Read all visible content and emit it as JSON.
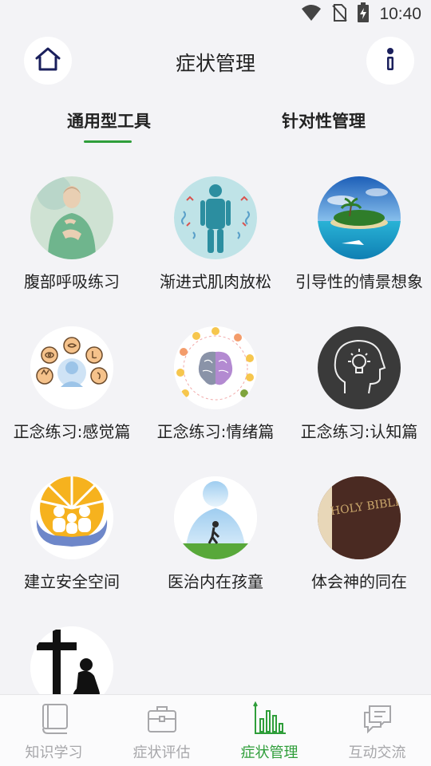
{
  "status_bar": {
    "time": "10:40",
    "icons": [
      "wifi-icon",
      "no-sim-icon",
      "battery-charging-icon"
    ]
  },
  "header": {
    "title": "症状管理",
    "left_icon": "home-icon",
    "right_icon": "info-icon"
  },
  "tabs": [
    {
      "label": "通用型工具",
      "active": true
    },
    {
      "label": "针对性管理",
      "active": false
    }
  ],
  "tools": [
    {
      "label": "腹部呼吸练习",
      "icon": "abdominal-breathing-image"
    },
    {
      "label": "渐进式肌肉放松",
      "icon": "muscle-relaxation-image"
    },
    {
      "label": "引导性的情景想象",
      "icon": "guided-imagery-image"
    },
    {
      "label": "正念练习:感觉篇",
      "icon": "mindfulness-senses-image"
    },
    {
      "label": "正念练习:情绪篇",
      "icon": "mindfulness-emotions-image"
    },
    {
      "label": "正念练习:认知篇",
      "icon": "mindfulness-cognition-image"
    },
    {
      "label": "建立安全空间",
      "icon": "safe-space-image"
    },
    {
      "label": "医治内在孩童",
      "icon": "inner-child-image"
    },
    {
      "label": "体会神的同在",
      "icon": "holy-bible-image",
      "image_text": "HOLY BIBLE"
    },
    {
      "label": "",
      "icon": "cross-prayer-image"
    }
  ],
  "bottom_nav": [
    {
      "label": "知识学习",
      "icon": "book-icon",
      "active": false
    },
    {
      "label": "症状评估",
      "icon": "briefcase-icon",
      "active": false
    },
    {
      "label": "症状管理",
      "icon": "bar-chart-icon",
      "active": true
    },
    {
      "label": "互动交流",
      "icon": "chat-bubbles-icon",
      "active": false
    }
  ],
  "colors": {
    "accent": "#2f9e3a",
    "background": "#f3f3f6",
    "inactive_nav": "#a7a7aa"
  }
}
